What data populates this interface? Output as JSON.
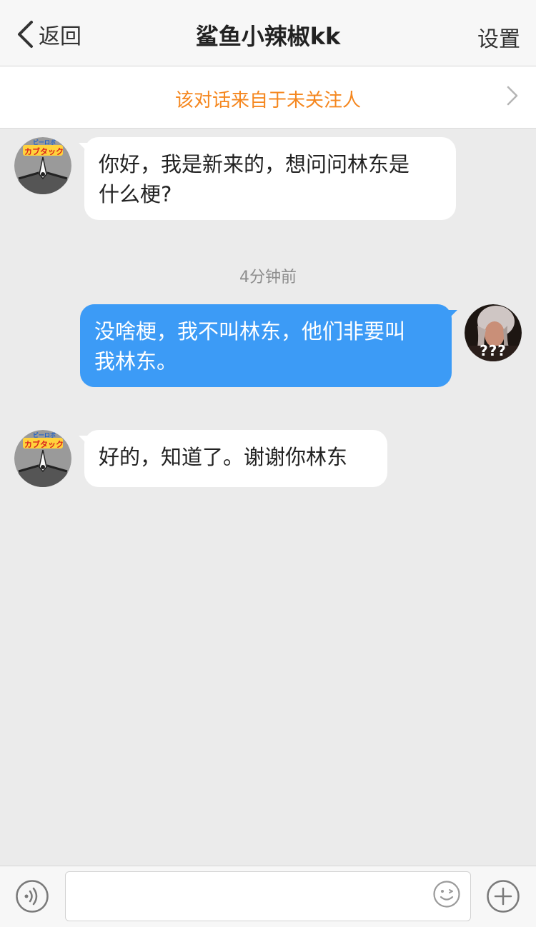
{
  "navbar": {
    "back_label": "返回",
    "title": "鲨鱼小辣椒kk",
    "settings_label": "设置"
  },
  "notice": {
    "text": "该对话来自于未关注人"
  },
  "messages": [
    {
      "direction": "incoming",
      "text_line1": "你好，我是新来的，想问问林东是",
      "text_line2": "什么梗?"
    },
    {
      "direction": "outgoing",
      "text_line1": "没啥梗，我不叫林东，他们非要叫",
      "text_line2": "我林东。"
    },
    {
      "direction": "incoming",
      "text_line1": "好的，知道了。谢谢你林东"
    }
  ],
  "timestamp": "4分钟前",
  "avatars": {
    "sender_badge_text": "カブタック",
    "sender_top_text": "ビーロボ",
    "self_caption": "???"
  },
  "inputbar": {
    "message_value": "",
    "voice_icon": "voice-icon",
    "emoji_icon": "emoji-icon",
    "add_icon": "plus-icon"
  },
  "colors": {
    "accent_orange": "#f5871f",
    "outgoing_bubble": "#3c9bf6",
    "background": "#ebebeb"
  }
}
